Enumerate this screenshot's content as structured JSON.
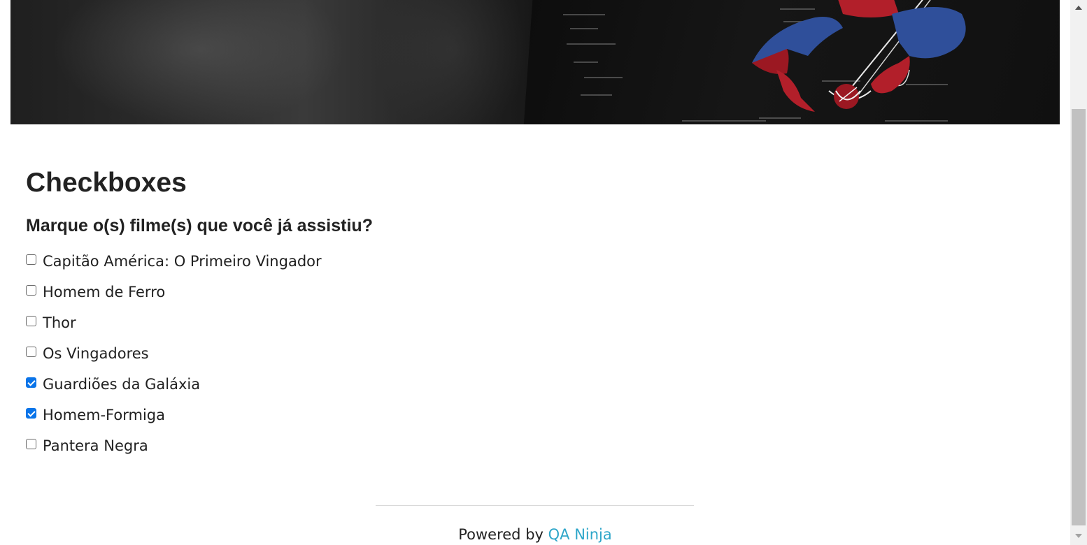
{
  "banner": {
    "image": "spider-man-hero-banner"
  },
  "page": {
    "title": "Checkboxes",
    "question": "Marque o(s) filme(s) que você já assistiu?"
  },
  "options": [
    {
      "label": "Capitão América: O Primeiro Vingador",
      "checked": false
    },
    {
      "label": "Homem de Ferro",
      "checked": false
    },
    {
      "label": "Thor",
      "checked": false
    },
    {
      "label": "Os Vingadores",
      "checked": false
    },
    {
      "label": "Guardiões da Galáxia",
      "checked": true
    },
    {
      "label": "Homem-Formiga",
      "checked": true
    },
    {
      "label": "Pantera Negra",
      "checked": false
    }
  ],
  "footer": {
    "prefix": "Powered by ",
    "link_label": "QA Ninja"
  },
  "colors": {
    "checkbox_checked": "#0a74e9",
    "link": "#2ea6c9"
  }
}
